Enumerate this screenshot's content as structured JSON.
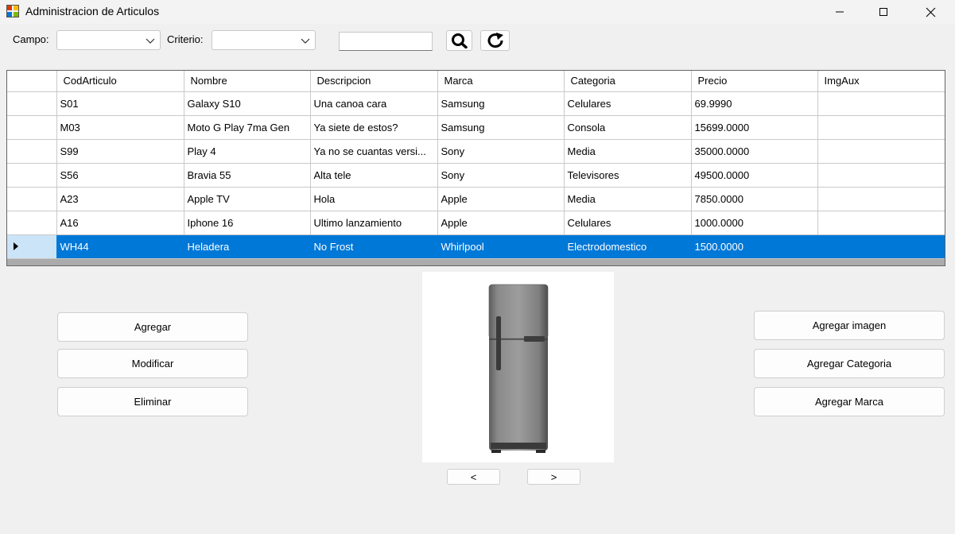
{
  "window": {
    "title": "Administracion de Articulos",
    "icons": {
      "app": "app-icon",
      "minimize": "minimize-icon",
      "maximize": "maximize-icon",
      "close": "close-icon"
    }
  },
  "filters": {
    "campo_label": "Campo:",
    "campo_value": "",
    "criterio_label": "Criterio:",
    "criterio_value": "",
    "search_text": "",
    "search_icon": "magnifier-icon",
    "refresh_icon": "refresh-icon"
  },
  "grid": {
    "columns": [
      "CodArticulo",
      "Nombre",
      "Descripcion",
      "Marca",
      "Categoria",
      "Precio",
      "ImgAux"
    ],
    "rows": [
      [
        "S01",
        "Galaxy S10",
        "Una canoa cara",
        "Samsung",
        "Celulares",
        "69.9990",
        ""
      ],
      [
        "M03",
        "Moto G Play 7ma Gen",
        "Ya siete de estos?",
        "Samsung",
        "Consola",
        "15699.0000",
        ""
      ],
      [
        "S99",
        "Play 4",
        "Ya no se cuantas versi...",
        "Sony",
        "Media",
        "35000.0000",
        ""
      ],
      [
        "S56",
        "Bravia 55",
        "Alta tele",
        "Sony",
        "Televisores",
        "49500.0000",
        ""
      ],
      [
        "A23",
        "Apple TV",
        "Hola",
        "Apple",
        "Media",
        "7850.0000",
        ""
      ],
      [
        "A16",
        "Iphone 16",
        "Ultimo lanzamiento",
        "Apple",
        "Celulares",
        "1000.0000",
        ""
      ],
      [
        "WH44",
        "Heladera",
        "No Frost",
        "Whirlpool",
        "Electrodomestico",
        "1500.0000",
        ""
      ]
    ],
    "selected_row": 6,
    "selection_color": "#0078d7"
  },
  "actions": {
    "agregar": "Agregar",
    "modificar": "Modificar",
    "eliminar": "Eliminar",
    "agregar_imagen": "Agregar imagen",
    "agregar_categoria": "Agregar Categoria",
    "agregar_marca": "Agregar Marca"
  },
  "image_nav": {
    "prev": "<",
    "next": ">",
    "image_subject": "refrigerator-image"
  }
}
